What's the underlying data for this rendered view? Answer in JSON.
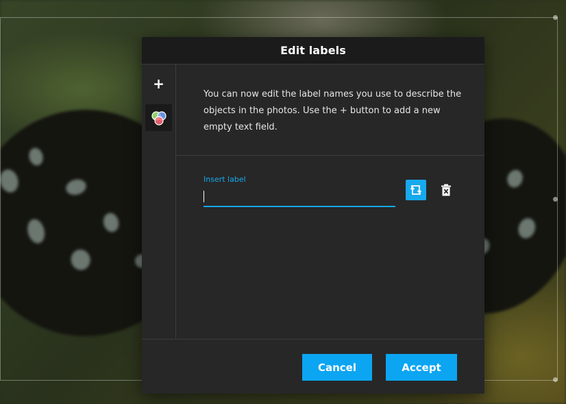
{
  "dialog": {
    "title": "Edit labels",
    "description": "You can now edit the label names you use to describe the objects in the photos. Use the + button to add a new empty text field."
  },
  "sidebar": {
    "add_label": "+",
    "add_icon": "plus-icon",
    "palette_icon": "color-palette-icon"
  },
  "label_field": {
    "floating_label": "Insert label",
    "value": "",
    "convert_icon": "crop-rotate-icon",
    "delete_icon": "trash-icon"
  },
  "footer": {
    "cancel_label": "Cancel",
    "accept_label": "Accept"
  },
  "colors": {
    "accent": "#0ca5f2",
    "dialog_bg": "#272727",
    "header_bg": "#1b1b1b"
  }
}
